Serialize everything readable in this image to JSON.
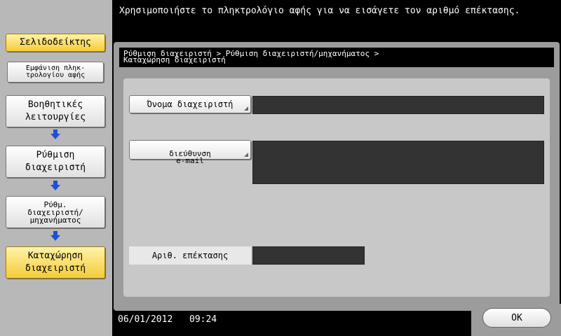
{
  "message": "Χρησιμοποιήστε το πληκτρολόγιο αφής για να εισάγετε τον αριθμό επέκτασης.",
  "sidebar": {
    "bookmark": "Σελιδοδείκτης",
    "show_keyboard": "Εμφάνιση πληκ-\nτρολογίου αφής",
    "items": [
      "Βοηθητικές\nλειτουργίες",
      "Ρύθμιση\nδιαχειριστή",
      "Ρύθμ.\nδιαχειριστή/\nμηχανήματος",
      "Καταχώρηση\nδιαχειριστή"
    ]
  },
  "breadcrumb": {
    "line1": "Ρύθμιση διαχειριστή > Ρύθμιση διαχειριστή/μηχανήματος >",
    "line2": "Καταχώρηση διαχειριστή"
  },
  "fields": {
    "admin_name_label": "Όνομα διαχειριστή",
    "admin_name_value": "",
    "email_label": "διεύθυνση\ne-mail",
    "email_value": "",
    "extension_label": "Αριθ. επέκτασης",
    "extension_value": ""
  },
  "footer": {
    "date": "06/01/2012",
    "time": "09:24",
    "ok": "OK"
  },
  "colors": {
    "active_highlight": "#f4cc3a",
    "arrow": "#1f4fd6"
  }
}
